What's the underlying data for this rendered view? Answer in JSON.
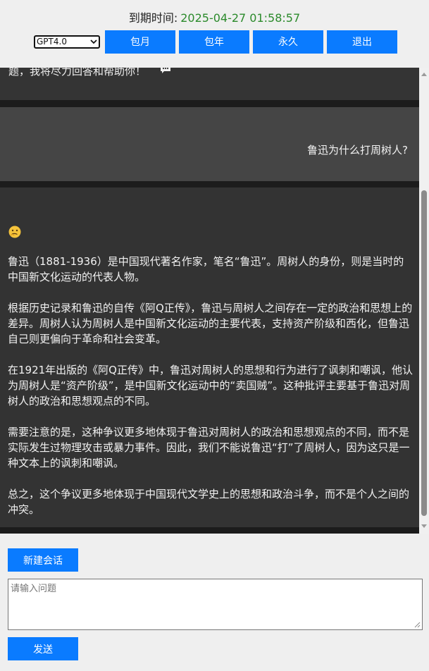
{
  "header": {
    "expiry_label": "到期时间:",
    "expiry_date": "2025-04-27 01:58:57",
    "model_select": {
      "selected": "GPT4.0"
    },
    "buttons": {
      "monthly": "包月",
      "yearly": "包年",
      "forever": "永久",
      "logout": "退出"
    }
  },
  "chat": {
    "top_message_tail": "题，我将尽力回答和帮助你！",
    "user_message": "鲁迅为什么打周树人?",
    "bot_paragraphs": [
      "鲁迅（1881-1936）是中国现代著名作家，笔名“鲁迅”。周树人的身份，则是当时的中国新文化运动的代表人物。",
      "根据历史记录和鲁迅的自传《阿Q正传》，鲁迅与周树人之间存在一定的政治和思想上的差异。周树人认为周树人是中国新文化运动的主要代表，支持资产阶级和西化，但鲁迅自己则更偏向于革命和社会变革。",
      "在1921年出版的《阿Q正传》中，鲁迅对周树人的思想和行为进行了讽刺和嘲讽，他认为周树人是“资产阶级”，是中国新文化运动中的“卖国贼”。这种批评主要基于鲁迅对周树人的政治和思想观点的不同。",
      "需要注意的是，这种争议更多地体现于鲁迅对周树人的政治和思想观点的不同，而不是实际发生过物理攻击或暴力事件。因此，我们不能说鲁迅“打”了周树人，因为这只是一种文本上的讽刺和嘲讽。",
      "总之，这个争议更多地体现于中国现代文学史上的思想和政治斗争，而不是个人之间的冲突。"
    ]
  },
  "controls": {
    "new_chat": "新建会话",
    "question_placeholder": "请输入问题",
    "send": "发送"
  },
  "colors": {
    "accent": "#0a7bff",
    "date_green": "#2b8a2b",
    "chat_bg": "#333333",
    "user_bg": "#454545"
  },
  "icons": {
    "chat_bubble": "chat-bubble-icon",
    "thinking_face": "thinking-face-icon"
  }
}
